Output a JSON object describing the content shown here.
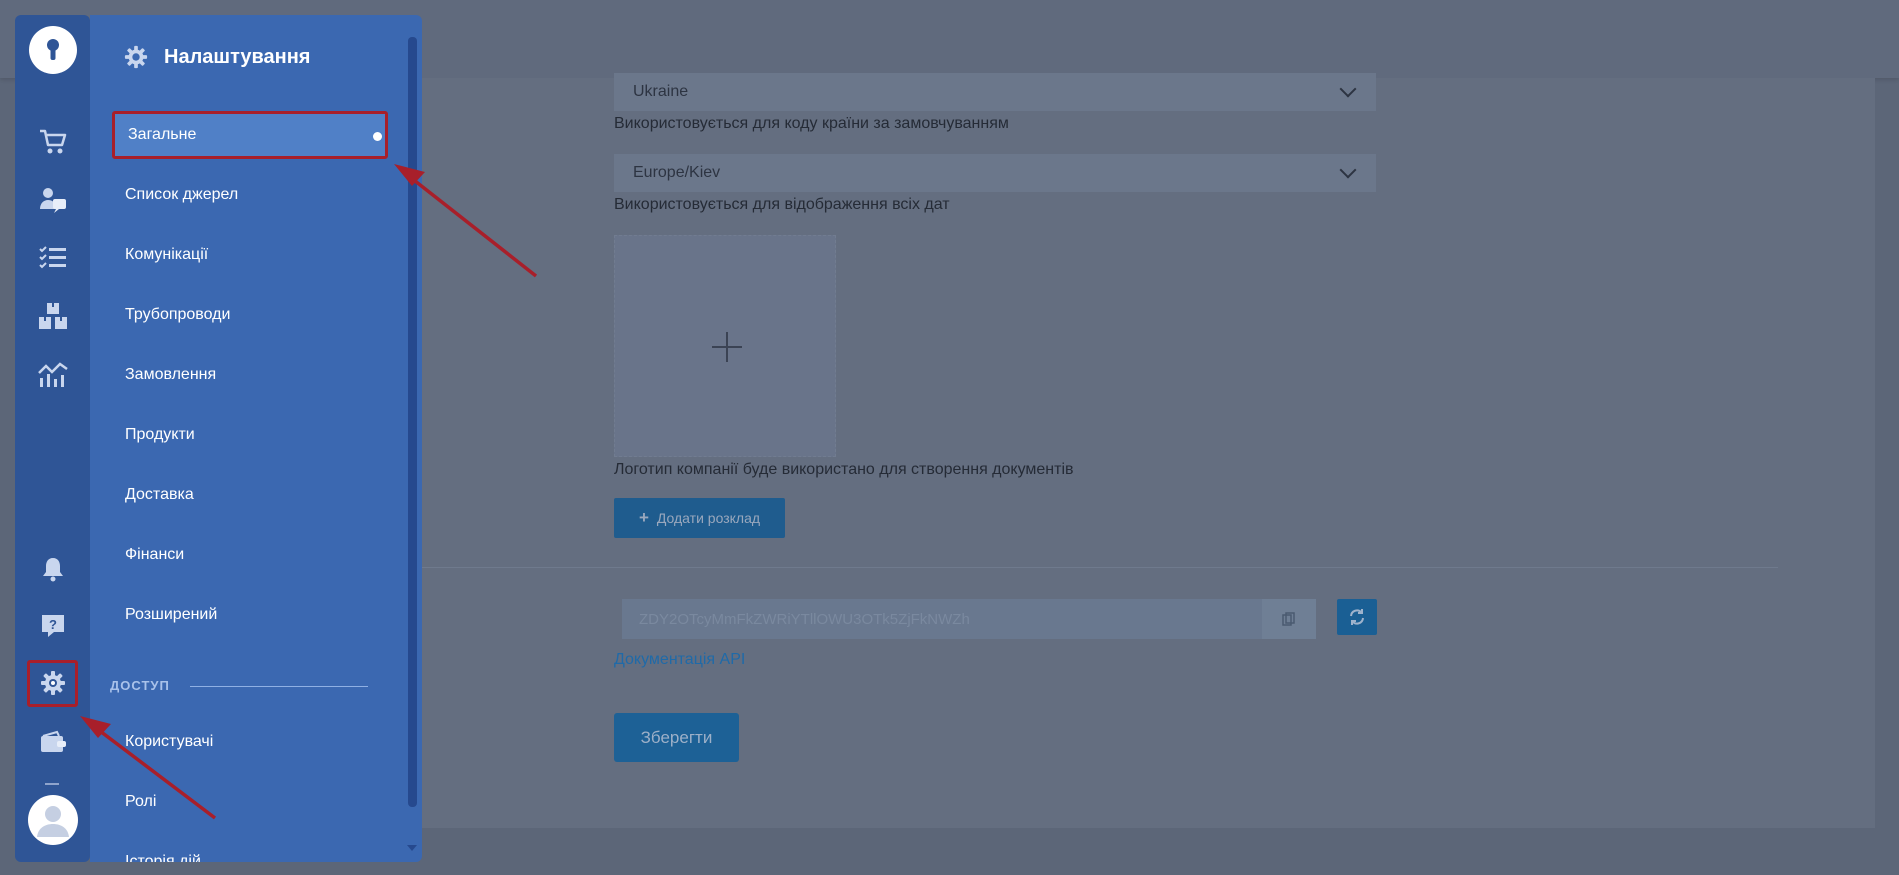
{
  "background": {
    "country_select": {
      "value": "Ukraine",
      "help": "Використовується для коду країни за замовчуванням"
    },
    "timezone_select": {
      "value": "Europe/Kiev",
      "help": "Використовується для відображення всіх дат"
    },
    "logo_help": "Логотип компанії буде використано для створення документів",
    "add_schedule_label": "Додати розклад",
    "api_key_value": "ZDY2OTcyMmFkZWRiYTllOWU3OTk5ZjFkNWZh",
    "api_docs_link": "Документація API",
    "save_label": "Зберегти"
  },
  "rail": {
    "icons": [
      "key-logo-icon",
      "cart-icon",
      "user-chat-icon",
      "checklist-icon",
      "boxes-icon",
      "analytics-icon",
      "bell-icon",
      "help-icon",
      "gear-icon",
      "wallet-icon",
      "avatar-icon"
    ]
  },
  "flyout": {
    "title": "Налаштування",
    "items": [
      {
        "label": "Загальне",
        "active": true
      },
      {
        "label": "Список джерел"
      },
      {
        "label": "Комунікації"
      },
      {
        "label": "Трубопроводи"
      },
      {
        "label": "Замовлення"
      },
      {
        "label": "Продукти"
      },
      {
        "label": "Доставка"
      },
      {
        "label": "Фінанси"
      },
      {
        "label": "Розширений"
      }
    ],
    "section_access": "ДОСТУП",
    "access_items": [
      {
        "label": "Користувачі"
      },
      {
        "label": "Ролі"
      },
      {
        "label": "Історія дій"
      }
    ]
  },
  "colors": {
    "rail": "#2f5596",
    "flyout": "#3b68b1",
    "active_item": "#5080c7",
    "annotation": "#a81f2a"
  }
}
